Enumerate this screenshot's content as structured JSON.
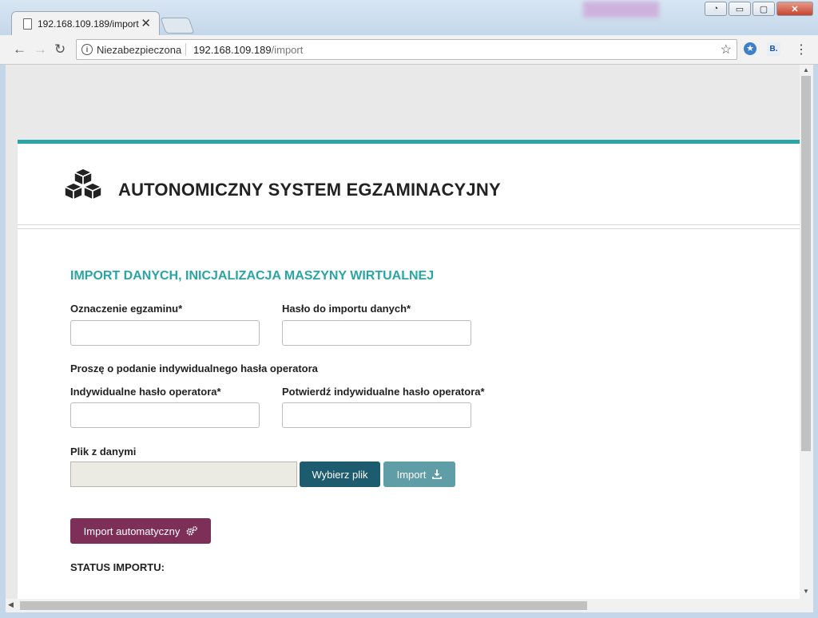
{
  "browser": {
    "tab_title": "192.168.109.189/import",
    "tab_close": "✕",
    "omnibox": {
      "security_label": "Niezabezpieczona",
      "host": "192.168.109.189",
      "path": "/import"
    },
    "ext_badge": "B.",
    "window_buttons": {
      "minimize": "▭",
      "maximize": "▢",
      "close": "✕"
    }
  },
  "page": {
    "app_title": "AUTONOMICZNY SYSTEM EGZAMINACYJNY",
    "section_title": "IMPORT DANYCH, INICJALIZACJA MASZYNY WIRTUALNEJ",
    "fields": {
      "exam_label": "Oznaczenie egzaminu*",
      "import_pass_label": "Hasło do importu danych*",
      "operator_prompt": "Proszę o podanie indywidualnego hasła operatora",
      "operator_pass_label": "Indywidualne hasło operatora*",
      "operator_pass_confirm_label": "Potwierdź indywidualne hasło operatora*",
      "file_label": "Plik z danymi"
    },
    "buttons": {
      "choose_file": "Wybierz plik",
      "import": "Import",
      "auto_import": "Import automatyczny"
    },
    "status_label": "STATUS IMPORTU:"
  },
  "colors": {
    "accent": "#2aa5a5",
    "choose_button": "#1d5b6e",
    "import_button": "#5f9ea7",
    "auto_button": "#7e2f58"
  }
}
